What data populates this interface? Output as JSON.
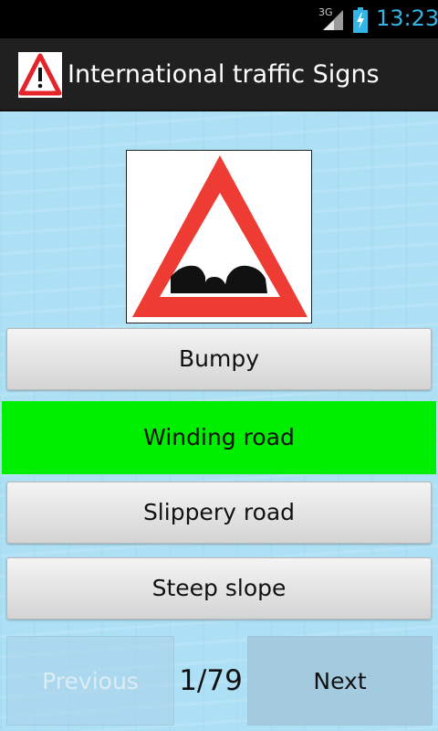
{
  "status_bar": {
    "network": "3G",
    "time": "13:23",
    "signal_icon": "signal-icon",
    "battery_icon": "battery-charging-icon",
    "accent_color": "#33b5e5"
  },
  "action_bar": {
    "title": "International traffic Signs",
    "icon": "warning-triangle-icon"
  },
  "quiz": {
    "sign_image": "bumpy-road-sign",
    "options": [
      {
        "label": "Bumpy",
        "highlighted": false
      },
      {
        "label": "Winding road",
        "highlighted": true
      },
      {
        "label": "Slippery road",
        "highlighted": false
      },
      {
        "label": "Steep slope",
        "highlighted": false
      }
    ],
    "highlight_color": "#00ee00"
  },
  "navigation": {
    "previous_label": "Previous",
    "previous_enabled": false,
    "counter": "1/79",
    "next_label": "Next"
  },
  "colors": {
    "background": "#aee0f5",
    "sign_red": "#ee3b34"
  }
}
